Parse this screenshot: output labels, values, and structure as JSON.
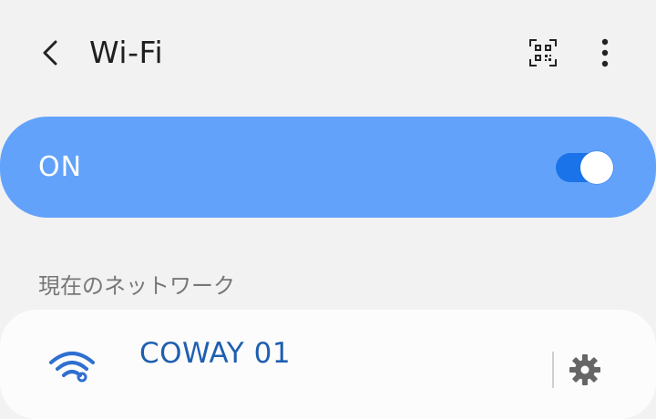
{
  "header": {
    "title": "Wi-Fi",
    "back_icon": "chevron-left-icon",
    "qr_icon": "qr-code-icon",
    "more_icon": "more-vertical-icon"
  },
  "wifi_toggle": {
    "label": "ON",
    "enabled": true,
    "card_color": "#62a2fb",
    "switch_color": "#1a73e8"
  },
  "current_network": {
    "section_title": "現在のネットワーク",
    "name": "COWAY 01",
    "signal_icon": "wifi-signal-icon",
    "settings_icon": "gear-icon",
    "name_color": "#1f5fb0"
  }
}
